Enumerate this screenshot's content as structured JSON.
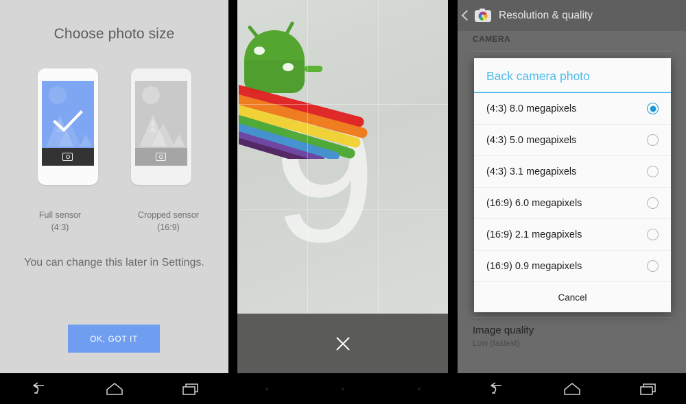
{
  "panel1": {
    "title": "Choose photo size",
    "options": [
      {
        "name": "Full sensor",
        "ratio": "(4:3)",
        "selected": true
      },
      {
        "name": "Cropped sensor",
        "ratio": "(16:9)",
        "selected": false
      }
    ],
    "note": "You can change this later in Settings.",
    "button_label": "OK, GOT IT",
    "colors": {
      "background": "#d6d6d6",
      "accent": "#6f9ef0",
      "phone_screen_selected": "#7ea6f2"
    }
  },
  "panel2": {
    "viewfinder_overlay_text": "9",
    "close_label": "×",
    "grid": "rule-of-thirds",
    "colors": {
      "frame": "#000000",
      "control_bar": "#5b5c59"
    }
  },
  "panel3": {
    "actionbar_title": "Resolution & quality",
    "section_header": "CAMERA",
    "dialog": {
      "title": "Back camera photo",
      "options": [
        {
          "label": "(4:3) 8.0 megapixels",
          "selected": true
        },
        {
          "label": "(4:3) 5.0 megapixels",
          "selected": false
        },
        {
          "label": "(4:3) 3.1 megapixels",
          "selected": false
        },
        {
          "label": "(16:9) 6.0 megapixels",
          "selected": false
        },
        {
          "label": "(16:9) 2.1 megapixels",
          "selected": false
        },
        {
          "label": "(16:9) 0.9 megapixels",
          "selected": false
        }
      ],
      "cancel_label": "Cancel"
    },
    "image_quality": {
      "title": "Image quality",
      "value": "Low (fastest)"
    },
    "colors": {
      "dialog_title": "#4fbbeb",
      "radio_selected": "#1b9ad6",
      "scrim": "#6b6b6b"
    }
  },
  "navbar": {
    "back_label": "Back",
    "home_label": "Home",
    "recents_label": "Recents"
  }
}
